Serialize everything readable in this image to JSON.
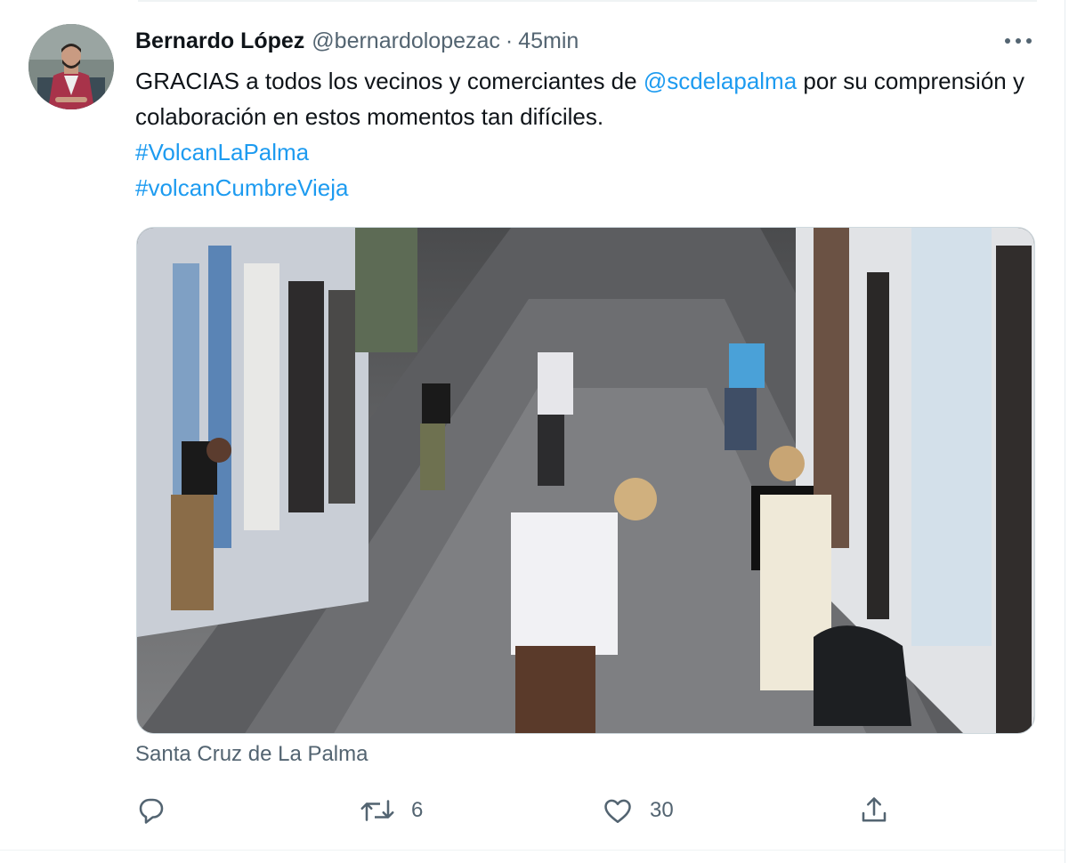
{
  "tweet": {
    "author_name": "Bernardo López",
    "handle": "@bernardolopezac",
    "separator": "·",
    "time": "45min",
    "text_before_mention": "GRACIAS a todos los vecinos y comerciantes de ",
    "mention": "@scdelapalma",
    "text_after_mention": " por su comprensión y colaboración en estos momentos tan difíciles.",
    "hashtags": [
      "#VolcanLaPalma",
      "#volcanCumbreVieja"
    ],
    "location": "Santa Cruz de La Palma"
  },
  "actions": {
    "reply_icon": "reply-icon",
    "retweet_icon": "retweet-icon",
    "retweet_count": "6",
    "like_icon": "heart-icon",
    "like_count": "30",
    "share_icon": "share-icon"
  },
  "colors": {
    "link": "#1d9bf0",
    "secondary_text": "#536471",
    "primary_text": "#0f1419",
    "border": "#cfd9de"
  }
}
